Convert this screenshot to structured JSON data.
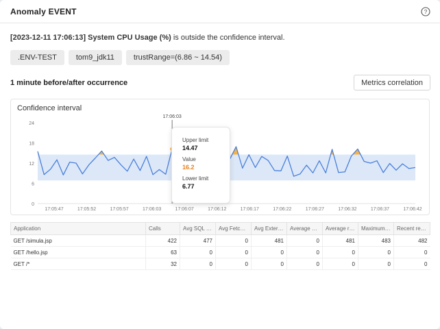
{
  "header": {
    "title": "Anomaly EVENT",
    "help_icon": "question-circle-icon"
  },
  "alert": {
    "timestamp": "[2023-12-11 17:06:13]",
    "metric": "System CPU Usage (%)",
    "message": " is outside the confidence interval."
  },
  "tags": [
    ".ENV-TEST",
    "tom9_jdk11",
    "trustRange=(6.86 ~ 14.54)"
  ],
  "section": {
    "title": "1 minute before/after occurrence",
    "metrics_button": "Metrics correlation"
  },
  "chart_data": {
    "type": "line",
    "title": "Confidence interval",
    "y_ticks": [
      0,
      6,
      12,
      18,
      24
    ],
    "ylim": [
      0,
      24
    ],
    "x_ticks": [
      "17:05:47",
      "17:05:52",
      "17:05:57",
      "17:06:03",
      "17:06:07",
      "17:06:12",
      "17:06:17",
      "17:06:22",
      "17:06:27",
      "17:06:32",
      "17:06:37",
      "17:06:42"
    ],
    "cursor_label": "17:06:03",
    "band": {
      "lower": 6.86,
      "upper": 14.54,
      "color": "#dce8f8"
    },
    "series": [
      {
        "color": "#4a7fd9",
        "values": [
          15.5,
          8.6,
          10.2,
          13.0,
          8.5,
          12.3,
          12.0,
          8.8,
          11.5,
          13.5,
          15.6,
          12.8,
          13.7,
          11.5,
          9.6,
          13.2,
          9.8,
          14.0,
          8.6,
          10.1,
          8.7,
          16.2,
          9.7,
          11.9,
          8.0,
          14.9,
          9.8,
          13.2,
          12.7,
          13.1,
          13.1,
          16.9,
          10.5,
          14.5,
          10.7,
          14.0,
          12.8,
          9.8,
          9.7,
          14.1,
          8.1,
          8.8,
          11.4,
          9.1,
          12.7,
          9.1,
          16.1,
          9.2,
          9.4,
          14.1,
          16.2,
          12.5,
          12.0,
          12.7,
          9.2,
          11.9,
          9.9,
          11.8,
          10.4,
          10.7
        ]
      }
    ],
    "highlight_color": "#f5a623"
  },
  "tooltip": {
    "upper_label": "Upper limit",
    "upper_value": "14.47",
    "value_label": "Value",
    "value": "16.2",
    "lower_label": "Lower limit",
    "lower_value": "6.77"
  },
  "table": {
    "headers": [
      "Application",
      "Calls",
      "Avg SQL time",
      "Avg Fetch time",
      "Avg External call time",
      "Average CPU time",
      "Average response time",
      "Maximum response time",
      "Recent response time"
    ],
    "rows": [
      [
        "GET /simula.jsp",
        "422",
        "477",
        "0",
        "481",
        "0",
        "481",
        "483",
        "482"
      ],
      [
        "GET /hello.jsp",
        "63",
        "0",
        "0",
        "0",
        "0",
        "0",
        "0",
        "0"
      ],
      [
        "GET /*",
        "32",
        "0",
        "0",
        "0",
        "0",
        "0",
        "0",
        "0"
      ]
    ]
  }
}
